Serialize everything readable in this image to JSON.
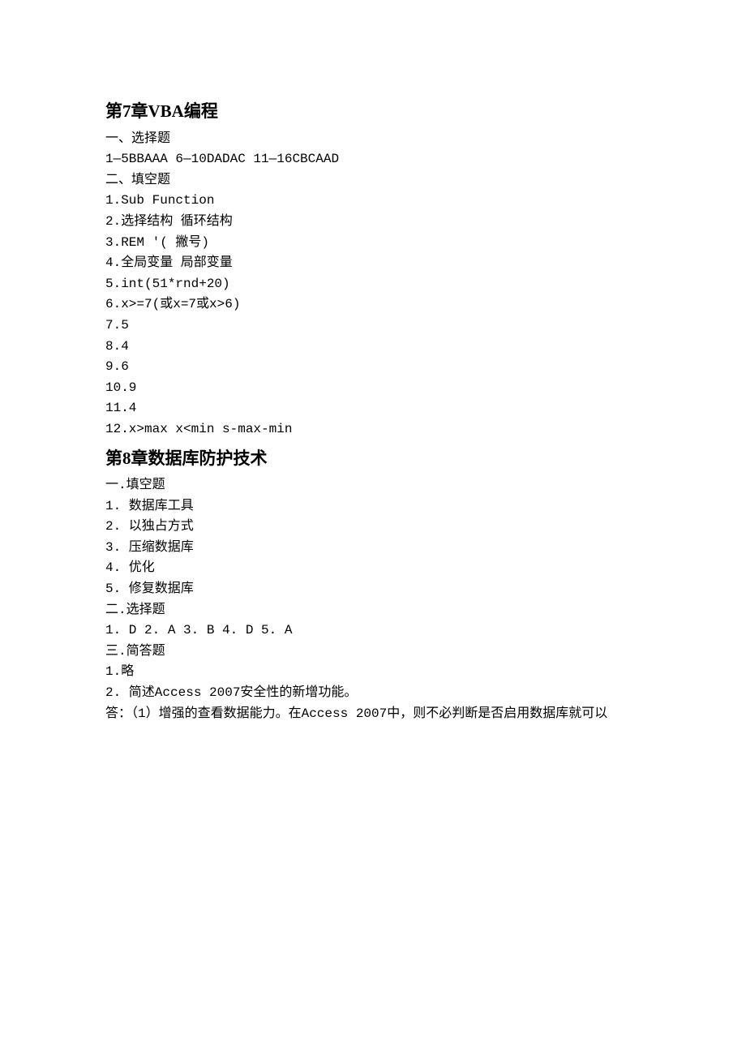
{
  "chapter7": {
    "title": "第7章VBA编程",
    "sections": [
      {
        "title": "一、选择题",
        "lines": [
          "1—5BBAAA 6—10DADAC 11—16CBCAAD"
        ]
      },
      {
        "title": "二、填空题",
        "lines": [
          "1.Sub Function",
          "2.选择结构 循环结构",
          "3.REM '( 撇号)",
          "4.全局变量 局部变量",
          "5.int(51*rnd+20)",
          "6.x>=7(或x=7或x>6)",
          "7.5",
          "8.4",
          "9.6",
          "10.9",
          "11.4",
          "12.x>max x<min s-max-min"
        ]
      }
    ]
  },
  "chapter8": {
    "title": "第8章数据库防护技术",
    "sections": [
      {
        "title": "一.填空题",
        "lines": [
          "1. 数据库工具",
          "2. 以独占方式",
          "3. 压缩数据库",
          "4. 优化",
          "5. 修复数据库"
        ]
      },
      {
        "title": "二.选择题",
        "lines": [
          "1. D 2. A 3. B 4. D 5. A"
        ]
      },
      {
        "title": "三.简答题",
        "lines": [
          "1.略",
          "2. 简述Access 2007安全性的新增功能。",
          "答：（1）增强的查看数据能力。在Access 2007中，则不必判断是否启用数据库就可以"
        ]
      }
    ]
  }
}
